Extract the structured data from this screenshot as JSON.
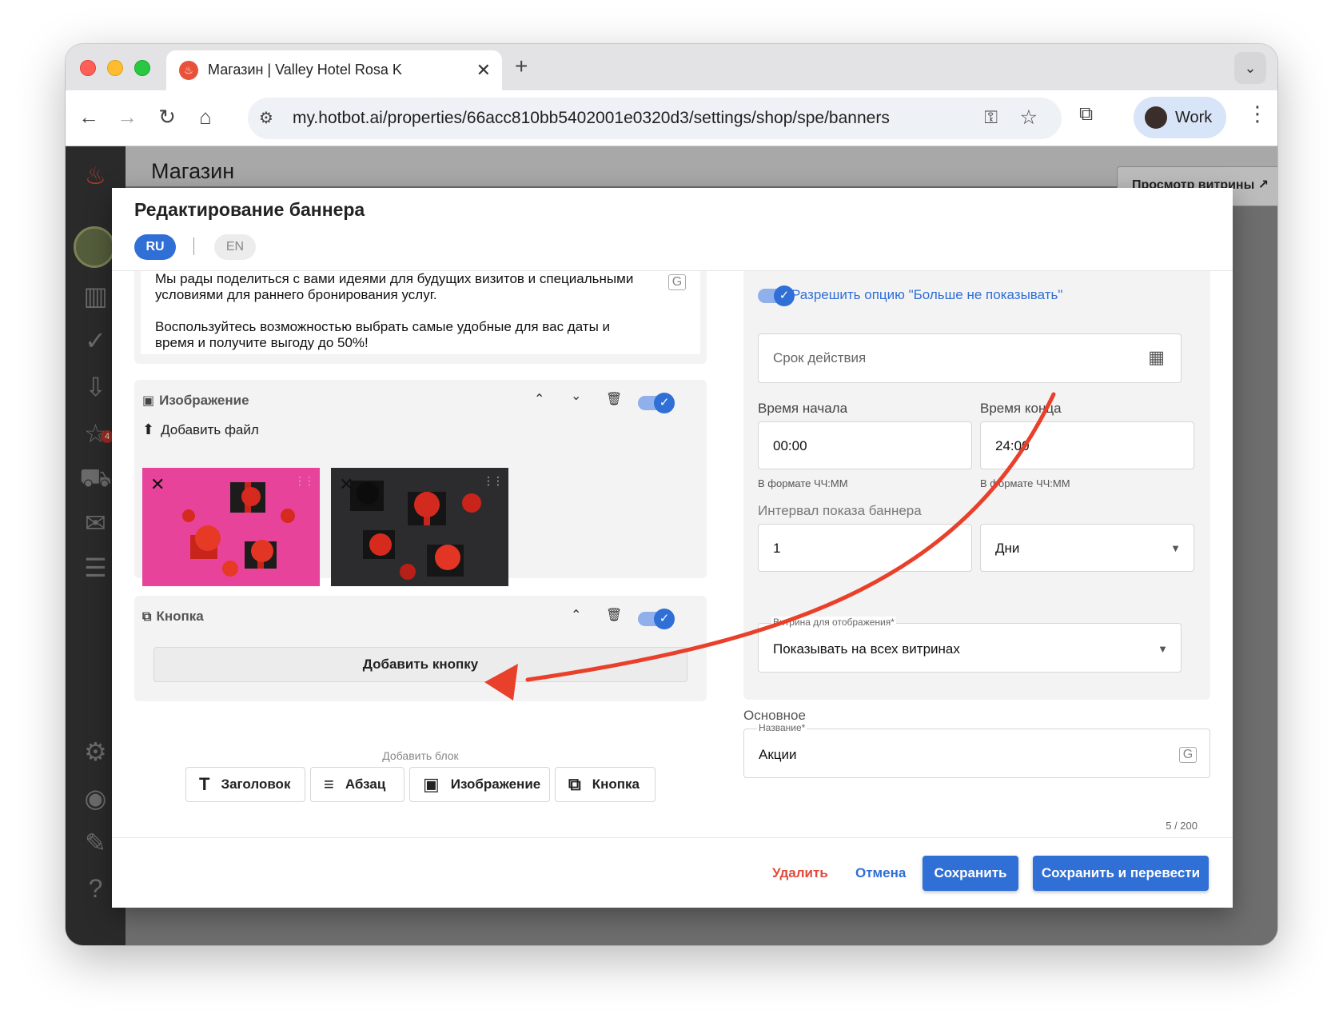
{
  "browser": {
    "tab_title": "Магазин | Valley Hotel Rosa K",
    "tab_favicon": "flame-icon",
    "url": "my.hotbot.ai/properties/66acc810bb5402001e0320d3/settings/shop/spe/banners",
    "profile_name": "Work"
  },
  "page": {
    "title": "Магазин",
    "preview_button": "Просмотр витрины ↗"
  },
  "sidebar": {
    "badge_count": "4",
    "items": [
      "flame-logo-icon",
      "avatar",
      "chart-icon",
      "check-circle-icon",
      "inbox-icon",
      "star-mail-icon",
      "cart-icon",
      "mail-send-icon",
      "chat-icon",
      "settings-icon",
      "user-icon",
      "pen-icon",
      "help-icon"
    ]
  },
  "dialog": {
    "title": "Редактирование баннера",
    "lang_ru": "RU",
    "lang_en": "EN",
    "paragraph_1": "Мы рады поделиться с вами идеями для будущих визитов и специальными условиями для раннего бронирования услуг.",
    "paragraph_2": "Воспользуйтесь возможностью выбрать самые удобные для вас даты и время и получите выгоду до 50%!",
    "image_block": {
      "title": "Изображение",
      "add_file": "Добавить файл",
      "enabled": true
    },
    "button_block": {
      "title": "Кнопка",
      "add_button": "Добавить кнопку",
      "enabled": true
    },
    "add_block": {
      "label": "Добавить блок",
      "heading": "Заголовок",
      "paragraph": "Абзац",
      "image": "Изображение",
      "button": "Кнопка"
    },
    "settings": {
      "allow_dont_show": "Разрешить опцию \"Больше не показывать\"",
      "validity_placeholder": "Срок действия",
      "start_time_label": "Время начала",
      "start_time": "00:00",
      "start_time_hint": "В формате ЧЧ:ММ",
      "end_time_label": "Время конца",
      "end_time": "24:00",
      "end_time_hint": "В формате ЧЧ:ММ",
      "interval_label": "Интервал показа баннера",
      "interval_value": "1",
      "interval_unit": "Дни",
      "storefront_label": "Витрина для отображения*",
      "storefront_value": "Показывать на всех витринах"
    },
    "main_section": {
      "title": "Основное",
      "name_label": "Название*",
      "name_value": "Акции",
      "counter": "5 / 200"
    },
    "footer": {
      "delete": "Удалить",
      "cancel": "Отмена",
      "save": "Сохранить",
      "save_translate": "Сохранить и перевести"
    }
  },
  "colors": {
    "primary": "#2f6fd6",
    "danger": "#e04a3a",
    "annotation_arrow": "#e8402a"
  }
}
